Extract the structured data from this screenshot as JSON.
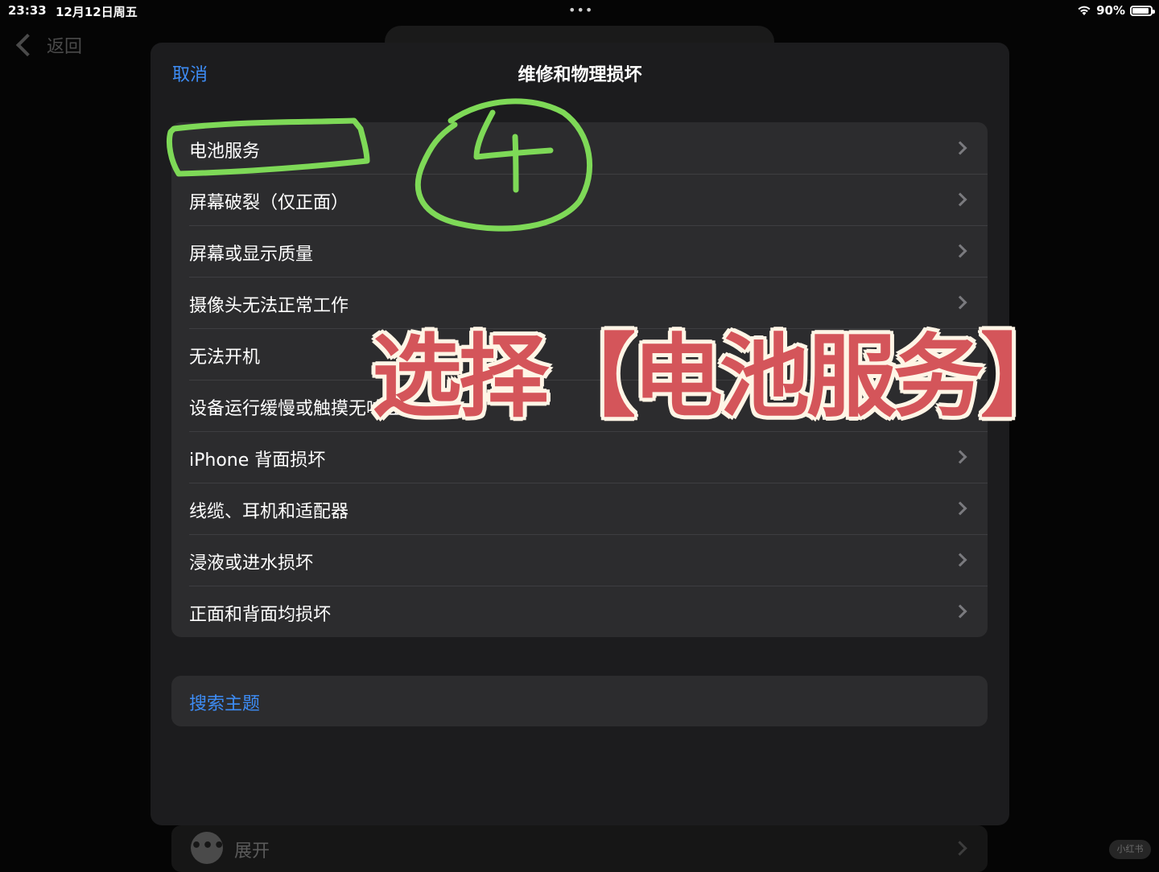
{
  "status_bar": {
    "time": "23:33",
    "date": "12月12日周五",
    "dots": "•••",
    "battery_percent": "90%",
    "battery_level": 0.9
  },
  "background": {
    "back_label": "返回",
    "expand_label": "展开",
    "watermark": "小红书"
  },
  "sheet": {
    "cancel_label": "取消",
    "title": "维修和物理损坏",
    "items": [
      {
        "label": "电池服务"
      },
      {
        "label": "屏幕破裂（仅正面）"
      },
      {
        "label": "屏幕或显示质量"
      },
      {
        "label": "摄像头无法正常工作"
      },
      {
        "label": "无法开机"
      },
      {
        "label": "设备运行缓慢或触摸无响应"
      },
      {
        "label": "iPhone 背面损坏"
      },
      {
        "label": "线缆、耳机和适配器"
      },
      {
        "label": "浸液或进水损坏"
      },
      {
        "label": "正面和背面均损坏"
      }
    ],
    "search_label": "搜索主题"
  },
  "overlay": {
    "caption": "选择【电池服务】",
    "step_number": "4",
    "highlight_color": "#7ed957",
    "caption_color": "#d4555a"
  },
  "colors": {
    "accent": "#3d8cf5",
    "sheet_bg": "#1c1c1e",
    "row_bg": "#2c2c2e"
  }
}
